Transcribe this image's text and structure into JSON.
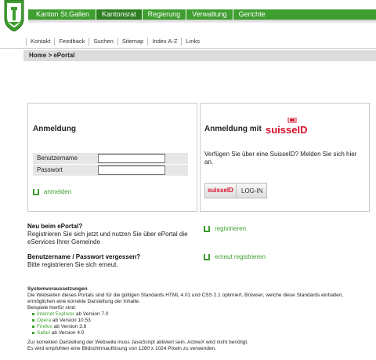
{
  "header": {
    "home_label": "Kanton St.Gallen",
    "nav": [
      "Kantonsrat",
      "Regierung",
      "Verwaltung",
      "Gerichte"
    ],
    "service": [
      "Kontakt",
      "Feedback",
      "Suchen",
      "Sitemap",
      "Index A-Z",
      "Links"
    ]
  },
  "breadcrumb": "Home > ePortal",
  "login": {
    "title": "Anmeldung",
    "username_label": "Benutzername",
    "password_label": "Passwort",
    "submit_label": "anmelden"
  },
  "suisse": {
    "title": "Anmeldung mit",
    "logo_text": "suisseID",
    "description": "Verfügen Sie über eine SuisseID? Melden Sie sich hier an.",
    "button_brand": "suisseID",
    "button_label": "LOG-IN"
  },
  "register": {
    "title": "Neu beim ePortal?",
    "text": "Registrieren Sie sich jetzt und nutzen Sie über ePortal die eServices Ihrer Gemeinde",
    "link": "registrieren"
  },
  "forgot": {
    "title": "Benutzername / Passwort vergessen?",
    "text": "Bitte registrieren Sie sich erneut.",
    "link": "erneut registrieren"
  },
  "system": {
    "title": "Systemvoraussetzungen",
    "intro": "Die Webseiten dieses Portals sind für die gültigen Standards HTML 4.01 und CSS 2.1 optimiert. Browser, welche diese Standards einhalten, ermöglichen eine korrekte Darstellung der Inhalte.",
    "examples": "Beispiele hierfür sind:",
    "browsers": [
      {
        "name": "Internet Explorer",
        "version": "ab Version 7.0"
      },
      {
        "name": "Opera",
        "version": "ab Version 10.53"
      },
      {
        "name": "Firefox",
        "version": "ab Version 3.6"
      },
      {
        "name": "Safari",
        "version": "ab Version 4.0"
      }
    ],
    "note1": "Zur korrekten Darstellung der Webseite muss JavaScript aktiviert sein. ActiveX wird nicht benötigt.",
    "note2": "Es wird empfohlen eine Bildschirmauflösung von 1280 x 1024 Pixeln zu verwenden."
  },
  "colors": {
    "brand_green": "#3e9e2f",
    "suisse_red": "#d3112a"
  }
}
